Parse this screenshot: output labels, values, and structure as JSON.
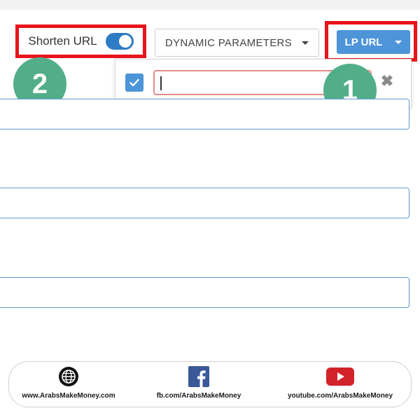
{
  "toolbar": {
    "shorten_label": "Shorten URL",
    "shorten_enabled": true,
    "dynamic_parameters_label": "DYNAMIC PARAMETERS",
    "lp_url_label": "LP URL"
  },
  "popup": {
    "checkbox_checked": true,
    "input_value": ""
  },
  "badges": {
    "one": "1",
    "two": "2"
  },
  "footer": {
    "website": "www.ArabsMakeMoney.com",
    "facebook": "fb.com/ArabsMakeMoney",
    "youtube": "youtube.com/ArabsMakeMoney"
  },
  "colors": {
    "highlight_red": "#e8141c",
    "accent_blue": "#4d94d9",
    "badge_green": "#52ae88",
    "field_border": "#5f9bd6"
  },
  "icons": {
    "website": "globe-icon",
    "facebook": "facebook-icon",
    "youtube": "youtube-icon",
    "popup_close": "close-icon",
    "popup_check": "check-icon"
  }
}
